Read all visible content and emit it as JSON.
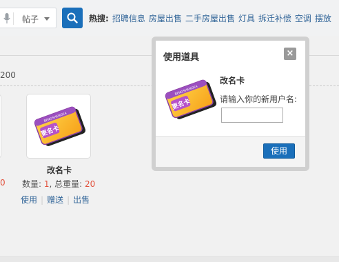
{
  "search": {
    "type_label": "帖子",
    "hot_label": "热搜:",
    "hot_links": [
      "招聘信息",
      "房屋出售",
      "二手房屋出售",
      "灯具",
      "拆迁补偿",
      "空调",
      "摆放"
    ]
  },
  "content": {
    "count_fragment": "200",
    "left_fragment": "0",
    "item": {
      "name": "改名卡",
      "qty_label": "数量: ",
      "qty": "1",
      "weight_label": ", 总重量: ",
      "weight": "20",
      "actions": [
        "使用",
        "赠送",
        "出售"
      ]
    }
  },
  "dialog": {
    "title": "使用道具",
    "close": "×",
    "item_name": "改名卡",
    "prompt": "请输入你的新用户名:",
    "input_value": "",
    "submit_label": "使用"
  },
  "card": {
    "text": "更名卡",
    "brand": "BENGSHENGKA"
  }
}
